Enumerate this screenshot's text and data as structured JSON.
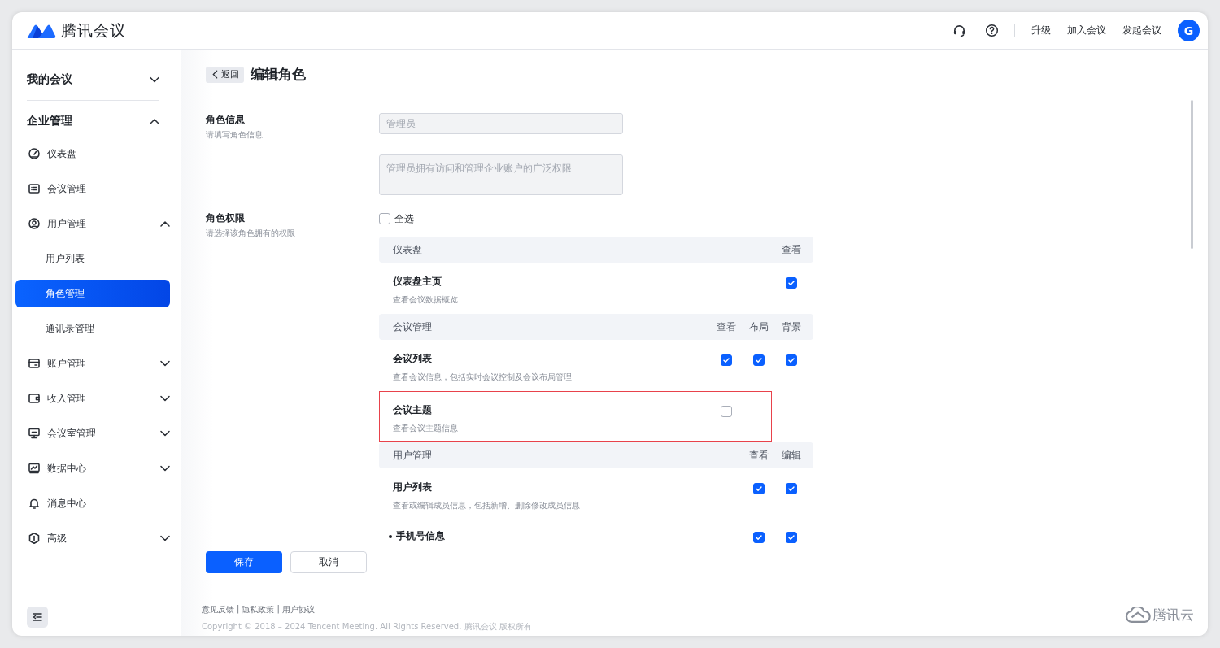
{
  "header": {
    "brand": "腾讯会议",
    "actions": [
      {
        "kind": "support"
      },
      {
        "kind": "help"
      }
    ],
    "links": [
      "升级",
      "加入会议",
      "发起会议"
    ],
    "avatar": "G"
  },
  "sidebar": {
    "sections": [
      {
        "label": "我的会议",
        "expanded": false
      },
      {
        "label": "企业管理",
        "expanded": true,
        "items": [
          {
            "label": "仪表盘",
            "selected": false
          },
          {
            "label": "会议管理",
            "selected": false
          },
          {
            "label": "用户管理",
            "selected": false,
            "expanded": true,
            "children": [
              {
                "label": "用户列表",
                "selected": false
              },
              {
                "label": "角色管理",
                "selected": true
              },
              {
                "label": "通讯录管理",
                "selected": false
              }
            ]
          },
          {
            "label": "账户管理",
            "selected": false,
            "expanded": false
          },
          {
            "label": "收入管理",
            "selected": false,
            "expanded": false
          },
          {
            "label": "会议室管理",
            "selected": false,
            "expanded": false
          },
          {
            "label": "数据中心",
            "selected": false,
            "expanded": false
          },
          {
            "label": "消息中心",
            "selected": false
          },
          {
            "label": "高级",
            "selected": false,
            "expanded": false
          }
        ]
      }
    ]
  },
  "page": {
    "back": "返回",
    "title": "编辑角色",
    "info": {
      "label": "角色信息",
      "hint": "请填写角色信息",
      "name_placeholder": "管理员",
      "desc_placeholder": "管理员拥有访问和管理企业账户的广泛权限"
    },
    "permissions": {
      "label": "角色权限",
      "hint": "请选择该角色拥有的权限",
      "select_all": {
        "label": "全选",
        "checked": false
      },
      "groups": [
        {
          "title": "仪表盘",
          "columns": [
            "查看"
          ],
          "items": [
            {
              "kind": "item",
              "name": "仪表盘主页",
              "desc": "查看会议数据概览",
              "checks": [
                true
              ]
            }
          ]
        },
        {
          "title": "会议管理",
          "columns": [
            "查看",
            "布局",
            "背景"
          ],
          "items": [
            {
              "kind": "item",
              "name": "会议列表",
              "desc": "查看会议信息，包括实时会议控制及会议布局管理",
              "checks": [
                true,
                true,
                true
              ]
            },
            {
              "kind": "item",
              "name": "会议主题",
              "desc": "查看会议主题信息",
              "highlighted": true,
              "checks": [
                false
              ]
            }
          ]
        },
        {
          "title": "用户管理",
          "columns": [
            "查看",
            "编辑"
          ],
          "items": [
            {
              "kind": "item",
              "name": "用户列表",
              "desc": "查看或编辑成员信息，包括新增、删除修改成员信息",
              "checks": [
                true,
                true
              ]
            },
            {
              "kind": "subitem",
              "name": "手机号信息",
              "checks": [
                true,
                true
              ]
            }
          ]
        }
      ]
    },
    "buttons": [
      {
        "kind": "primary",
        "label": "保存"
      },
      {
        "kind": "default",
        "label": "取消"
      }
    ]
  },
  "footer": {
    "links": [
      "意见反馈",
      "隐私政策",
      "用户协议"
    ],
    "separator": "|",
    "copyright": "Copyright © 2018 – 2024 Tencent Meeting. All Rights Reserved. 腾讯会议 版权所有",
    "brand": "腾讯云"
  }
}
